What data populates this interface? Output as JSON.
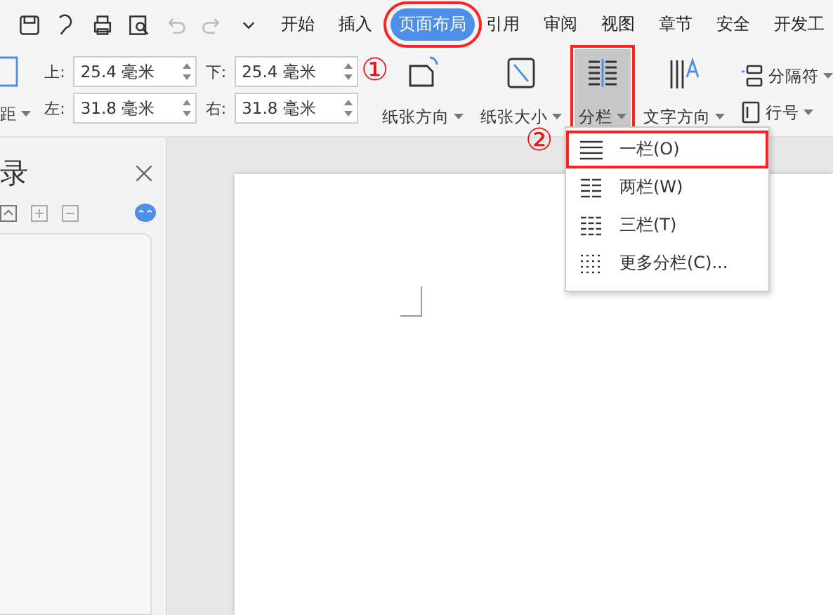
{
  "tabs": [
    {
      "label": "开始",
      "selected": false
    },
    {
      "label": "插入",
      "selected": false
    },
    {
      "label": "页面布局",
      "selected": true
    },
    {
      "label": "引用",
      "selected": false
    },
    {
      "label": "审阅",
      "selected": false
    },
    {
      "label": "视图",
      "selected": false
    },
    {
      "label": "章节",
      "selected": false
    },
    {
      "label": "安全",
      "selected": false
    },
    {
      "label": "开发工",
      "selected": false
    }
  ],
  "margin_button": {
    "label": "距"
  },
  "margins": [
    {
      "label": "上:",
      "value": "25.4 毫米"
    },
    {
      "label": "下:",
      "value": "25.4 毫米"
    },
    {
      "label": "左:",
      "value": "31.8 毫米"
    },
    {
      "label": "右:",
      "value": "31.8 毫米"
    }
  ],
  "ribbon_buttons": [
    {
      "label": "纸张方向",
      "kind": "orientation",
      "selected": false
    },
    {
      "label": "纸张大小",
      "kind": "size",
      "selected": false
    },
    {
      "label": "分栏",
      "kind": "columns",
      "selected": true
    },
    {
      "label": "文字方向",
      "kind": "text-direction",
      "selected": false
    }
  ],
  "small_buttons": [
    {
      "label": "分隔符",
      "kind": "break"
    },
    {
      "label": "行号",
      "kind": "line-number"
    }
  ],
  "callouts": [
    "①",
    "②"
  ],
  "nav_panel": {
    "title": "录"
  },
  "column_menu": [
    {
      "label": "一栏(O)",
      "kind": "one",
      "selected": true
    },
    {
      "label": "两栏(W)",
      "kind": "two",
      "selected": false
    },
    {
      "label": "三栏(T)",
      "kind": "three",
      "selected": false
    },
    {
      "label": "更多分栏(C)...",
      "kind": "more",
      "selected": false
    }
  ]
}
